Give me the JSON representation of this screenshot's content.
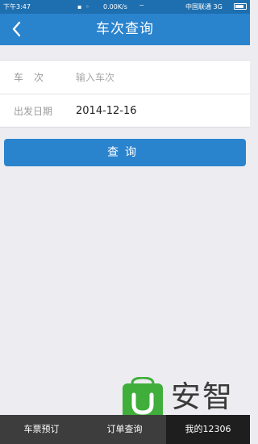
{
  "status_bar": {
    "time": "下午3:47",
    "net_speed": "0.00K/s",
    "carrier": "中国联通 3G",
    "icons": [
      "notification-icon",
      "alarm-icon",
      "wifi-icon",
      "signal-icon",
      "battery-icon"
    ]
  },
  "header": {
    "title": "车次查询",
    "back_icon": "chevron-left-icon"
  },
  "form": {
    "train_label": "车次",
    "train_placeholder": "输入车次",
    "date_label": "出发日期",
    "date_value": "2014-12-16"
  },
  "query_button": {
    "label": "查询"
  },
  "bottom_nav": {
    "items": [
      {
        "label": "车票预订",
        "active": false
      },
      {
        "label": "订单查询",
        "active": false
      },
      {
        "label": "我的12306",
        "active": true
      }
    ]
  },
  "watermark": {
    "text": "安智",
    "logo_icon": "anzhi-logo-icon"
  },
  "colors": {
    "primary": "#2a83cd",
    "status_bar": "#1e6fb0",
    "background": "#ececf1",
    "nav_background": "#3d3d3d",
    "nav_active": "#1e1e1e"
  }
}
